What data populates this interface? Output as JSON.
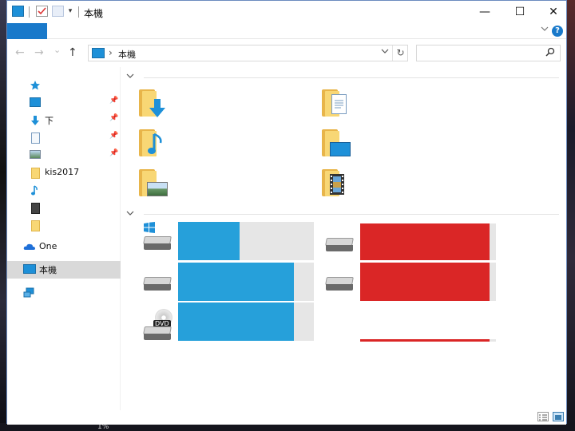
{
  "window": {
    "title": "本機",
    "controls": {
      "minimize": "—",
      "maximize": "☐",
      "close": "✕"
    }
  },
  "ribbon": {
    "file_tab": "",
    "expand_icon": "chevron-down",
    "help": "?"
  },
  "nav": {
    "back": "←",
    "forward": "→",
    "recent": "⌄",
    "up": "↑",
    "address": {
      "separator": "›",
      "crumb": "本機",
      "dropdown": "⌵",
      "refresh": "↻"
    },
    "search": {
      "placeholder": "",
      "icon": "⚲"
    }
  },
  "sidebar": {
    "items": [
      {
        "icon": "star-icon",
        "label": "",
        "pinned": false
      },
      {
        "icon": "desktop-icon",
        "label": "",
        "pinned": true
      },
      {
        "icon": "download-icon",
        "label": "下",
        "pinned": true
      },
      {
        "icon": "document-icon",
        "label": "",
        "pinned": true
      },
      {
        "icon": "picture-icon",
        "label": "",
        "pinned": true
      },
      {
        "icon": "folder-icon",
        "label": "kis2017",
        "pinned": false
      },
      {
        "icon": "music-icon",
        "label": "",
        "pinned": false
      },
      {
        "icon": "video-icon",
        "label": "",
        "pinned": false
      },
      {
        "icon": "folder-icon",
        "label": "",
        "pinned": false
      },
      {
        "icon": "onedrive-icon",
        "label": "One",
        "pinned": false
      },
      {
        "icon": "this-pc-icon",
        "label": "本機",
        "pinned": false,
        "selected": true
      },
      {
        "icon": "network-icon",
        "label": "",
        "pinned": false
      }
    ]
  },
  "content": {
    "folders": [
      {
        "type": "downloads"
      },
      {
        "type": "documents"
      },
      {
        "type": "music"
      },
      {
        "type": "desktop"
      },
      {
        "type": "pictures"
      },
      {
        "type": "videos"
      }
    ],
    "drives": [
      {
        "kind": "system",
        "used_fraction": 0.45,
        "color": "#26a0da"
      },
      {
        "kind": "hdd",
        "used_fraction": 0.95,
        "color": "#da2626"
      },
      {
        "kind": "hdd",
        "used_fraction": 0.85,
        "color": "#26a0da"
      },
      {
        "kind": "hdd",
        "used_fraction": 0.95,
        "color": "#da2626"
      },
      {
        "kind": "dvd",
        "used_fraction": 0.85,
        "color": "#26a0da",
        "badge": "DVD"
      },
      {
        "kind": "hdd",
        "used_fraction": 0.95,
        "color": "#da2626"
      }
    ]
  },
  "statusbar": {
    "details_view": "details-view-icon",
    "large_icons_view": "large-icons-view-icon"
  },
  "desktop": {
    "taskbar_text": "1%"
  },
  "colors": {
    "accent": "#1979ca",
    "drive_ok": "#26a0da",
    "drive_full": "#da2626"
  }
}
